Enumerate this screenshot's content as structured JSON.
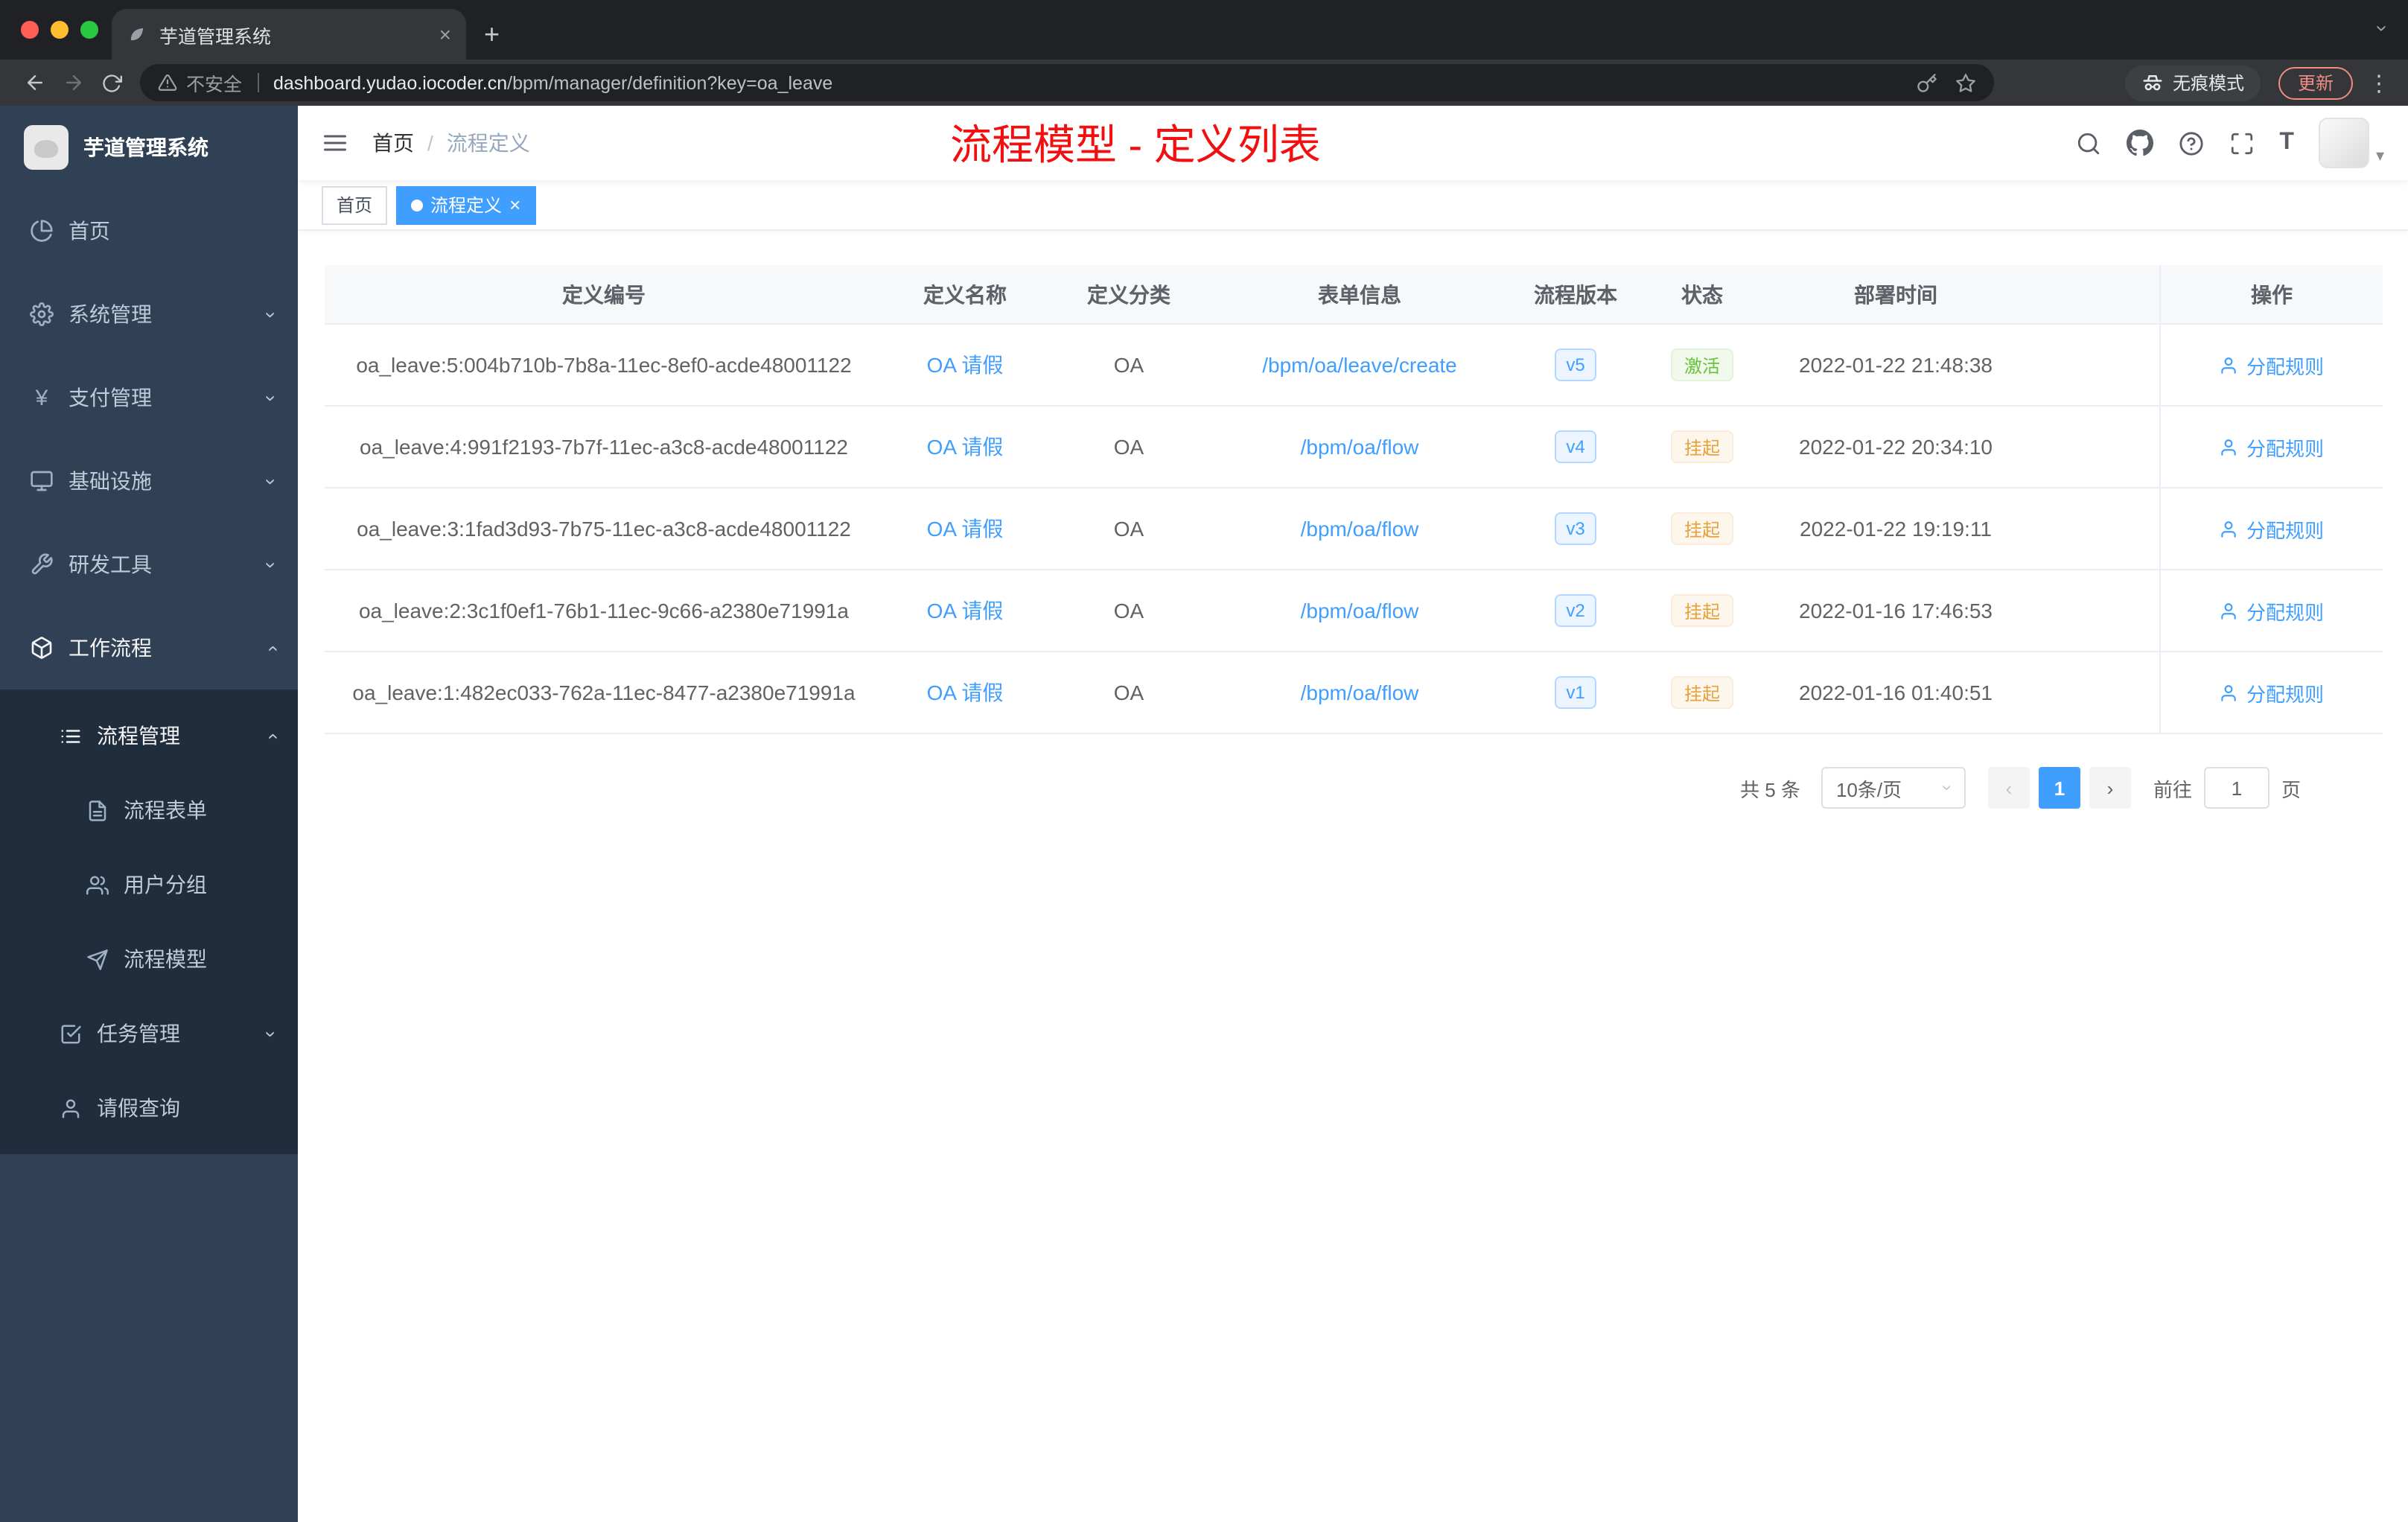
{
  "colors": {
    "accent": "#409eff",
    "annotation_red": "#f20f0f",
    "success": "#67c23a",
    "warning": "#e6a23c",
    "sidebar_bg": "#304156",
    "submenu_bg": "#1f2d3d"
  },
  "icons": {
    "close": "×",
    "plus": "+",
    "kebab": "⋮",
    "caret": "▾",
    "chev_right": "›",
    "chev_left": "‹",
    "yen": "¥",
    "fontsize": "T"
  },
  "browser": {
    "tab_title": "芋道管理系统",
    "security_label": "不安全",
    "url_domain": "dashboard.yudao.iocoder.cn",
    "url_path": "/bpm/manager/definition?key=oa_leave",
    "incognito_label": "无痕模式",
    "update_label": "更新"
  },
  "sidebar": {
    "logo_title": "芋道管理系统",
    "items": [
      {
        "label": "首页"
      },
      {
        "label": "系统管理"
      },
      {
        "label": "支付管理"
      },
      {
        "label": "基础设施"
      },
      {
        "label": "研发工具"
      },
      {
        "label": "工作流程"
      },
      {
        "label": "流程管理"
      },
      {
        "label": "流程表单"
      },
      {
        "label": "用户分组"
      },
      {
        "label": "流程模型"
      },
      {
        "label": "任务管理"
      },
      {
        "label": "请假查询"
      }
    ]
  },
  "header": {
    "breadcrumb_home": "首页",
    "breadcrumb_sep": "/",
    "breadcrumb_current": "流程定义",
    "annotation": "流程模型 - 定义列表"
  },
  "tags": {
    "home": "首页",
    "active": "流程定义"
  },
  "table": {
    "columns": [
      "定义编号",
      "定义名称",
      "定义分类",
      "表单信息",
      "流程版本",
      "状态",
      "部署时间",
      "操作"
    ],
    "rows": [
      {
        "id": "oa_leave:5:004b710b-7b8a-11ec-8ef0-acde48001122",
        "name": "OA 请假",
        "category": "OA",
        "form": "/bpm/oa/leave/create",
        "version": "v5",
        "status": "激活",
        "time": "2022-01-22 21:48:38",
        "action": "分配规则"
      },
      {
        "id": "oa_leave:4:991f2193-7b7f-11ec-a3c8-acde48001122",
        "name": "OA 请假",
        "category": "OA",
        "form": "/bpm/oa/flow",
        "version": "v4",
        "status": "挂起",
        "time": "2022-01-22 20:34:10",
        "action": "分配规则"
      },
      {
        "id": "oa_leave:3:1fad3d93-7b75-11ec-a3c8-acde48001122",
        "name": "OA 请假",
        "category": "OA",
        "form": "/bpm/oa/flow",
        "version": "v3",
        "status": "挂起",
        "time": "2022-01-22 19:19:11",
        "action": "分配规则"
      },
      {
        "id": "oa_leave:2:3c1f0ef1-76b1-11ec-9c66-a2380e71991a",
        "name": "OA 请假",
        "category": "OA",
        "form": "/bpm/oa/flow",
        "version": "v2",
        "status": "挂起",
        "time": "2022-01-16 17:46:53",
        "action": "分配规则"
      },
      {
        "id": "oa_leave:1:482ec033-762a-11ec-8477-a2380e71991a",
        "name": "OA 请假",
        "category": "OA",
        "form": "/bpm/oa/flow",
        "version": "v1",
        "status": "挂起",
        "time": "2022-01-16 01:40:51",
        "action": "分配规则"
      }
    ]
  },
  "pagination": {
    "total": "共 5 条",
    "page_size": "10条/页",
    "current_page": "1",
    "goto_label": "前往",
    "goto_value": "1",
    "unit_label": "页"
  }
}
